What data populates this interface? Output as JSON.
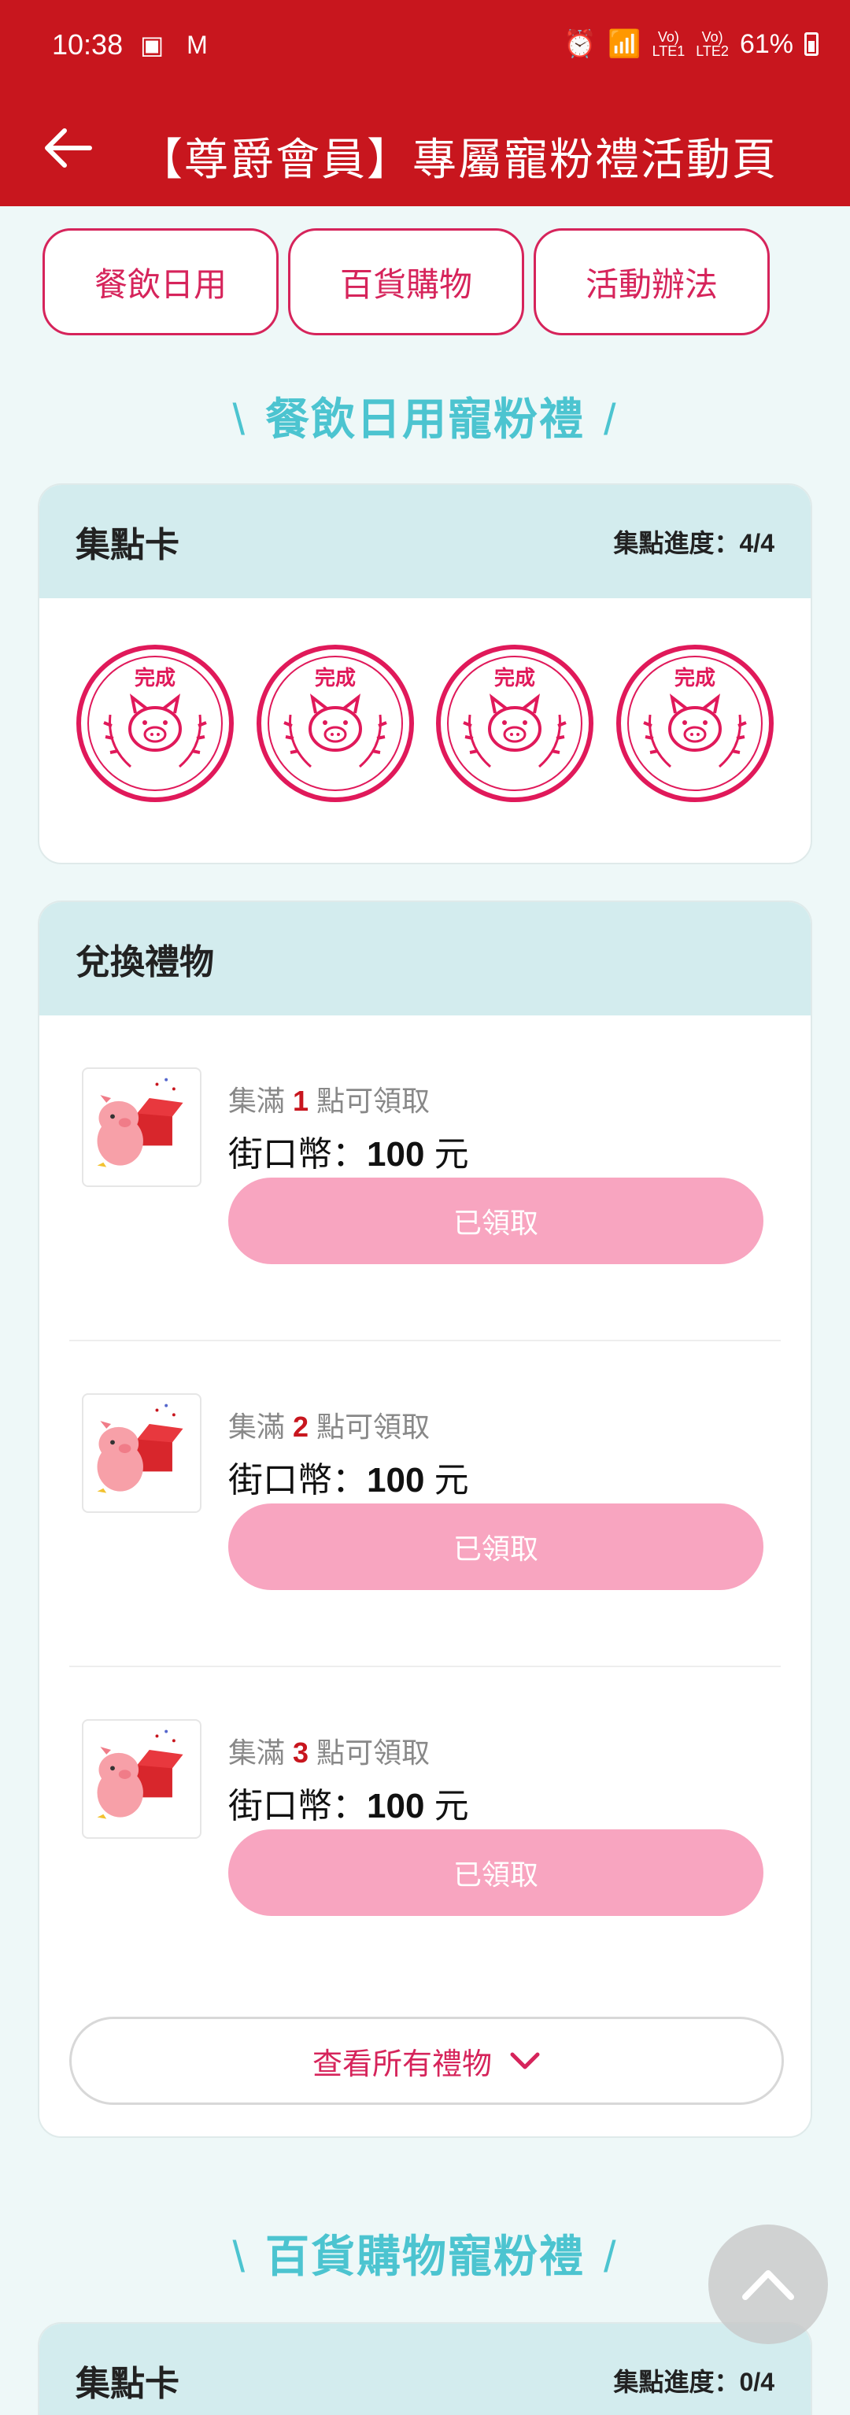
{
  "status": {
    "time": "10:38",
    "left_icons": "▣ M",
    "right": {
      "alarm": "⏰",
      "wifi": "📶",
      "sim1_top": "Vo)",
      "sim1_bottom": "LTE1",
      "sim2_top": "Vo)",
      "sim2_bottom": "LTE2",
      "battery": "61%"
    }
  },
  "appbar": {
    "title": "【尊爵會員】專屬寵粉禮活動頁",
    "back_icon": "arrow-left-icon"
  },
  "tabs": [
    "餐飲日用",
    "百貨購物",
    "活動辦法"
  ],
  "section1": {
    "title": "餐飲日用寵粉禮",
    "slash_left": "\\",
    "slash_right": "/",
    "stamp_card": {
      "title": "集點卡",
      "progress": "集點進度：4/4",
      "stamps": [
        "完成",
        "完成",
        "完成",
        "完成"
      ]
    },
    "gifts": {
      "title": "兌換禮物",
      "items": [
        {
          "cond_pre": "集滿",
          "points": "1",
          "cond_post": "點可領取",
          "name_label": "街口幣：",
          "name_value": "100",
          "name_unit": " 元",
          "button": "已領取"
        },
        {
          "cond_pre": "集滿",
          "points": "2",
          "cond_post": "點可領取",
          "name_label": "街口幣：",
          "name_value": "100",
          "name_unit": " 元",
          "button": "已領取"
        },
        {
          "cond_pre": "集滿",
          "points": "3",
          "cond_post": "點可領取",
          "name_label": "街口幣：",
          "name_value": "100",
          "name_unit": " 元",
          "button": "已領取"
        }
      ],
      "view_all": "查看所有禮物"
    }
  },
  "section2": {
    "title": "百貨購物寵粉禮",
    "slash_left": "\\",
    "slash_right": "/",
    "stamp_card": {
      "title": "集點卡",
      "progress": "集點進度：0/4"
    }
  },
  "colors": {
    "brand_red": "#c8161e",
    "accent_pink": "#d6245b",
    "teal": "#4cc4d0",
    "claimed_pink": "#f8a5c0"
  }
}
